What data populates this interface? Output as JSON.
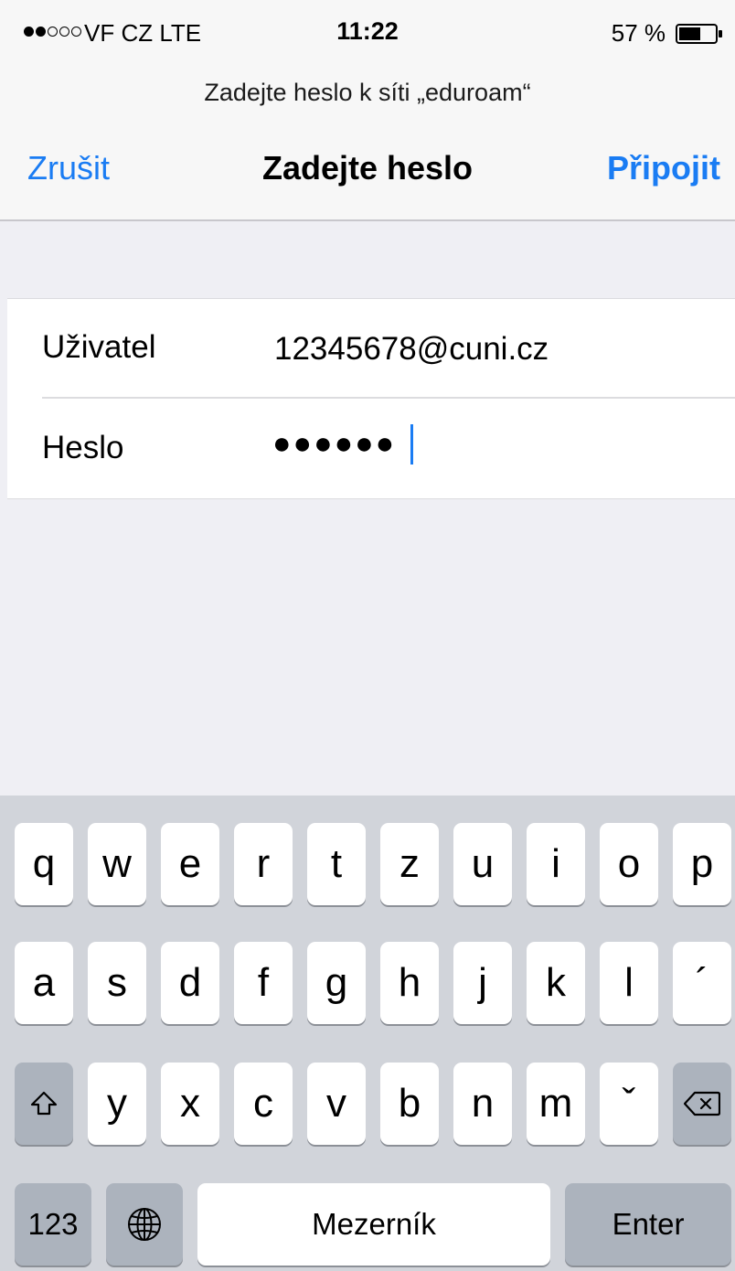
{
  "status_bar": {
    "carrier": "VF CZ  LTE",
    "time": "11:22",
    "battery": "57 %",
    "signal_bars": 2,
    "signal_total": 5,
    "battery_icon": "battery-icon"
  },
  "dialog": {
    "prompt": "Zadejte heslo k síti „eduroam“",
    "title": "Zadejte heslo",
    "cancel_label": "Zrušit",
    "connect_label": "Připojit"
  },
  "form": {
    "user_label": "Uživatel",
    "user_value": "12345678@cuni.cz",
    "password_label": "Heslo",
    "password_value": "●●●●●●"
  },
  "keyboard": {
    "row1": [
      "q",
      "w",
      "e",
      "r",
      "t",
      "z",
      "u",
      "i",
      "o",
      "p"
    ],
    "row2": [
      "a",
      "s",
      "d",
      "f",
      "g",
      "h",
      "j",
      "k",
      "l",
      "´"
    ],
    "row3": [
      "y",
      "x",
      "c",
      "v",
      "b",
      "n",
      "m",
      "ˇ"
    ],
    "shift_icon": "shift-icon",
    "delete_icon": "delete-icon",
    "numbers_label": "123",
    "globe_icon": "globe-icon",
    "space_label": "Mezerník",
    "enter_label": "Enter"
  },
  "colors": {
    "accent": "#1a7cf3",
    "keyboard_bg": "#d1d4da",
    "dark_key": "#acb3bd"
  }
}
